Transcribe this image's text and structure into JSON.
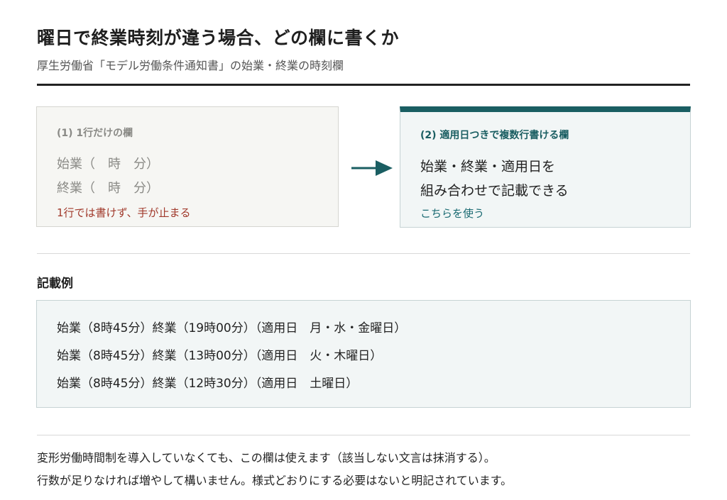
{
  "header": {
    "title": "曜日で終業時刻が違う場合、どの欄に書くか",
    "subtitle": "厚生労働省「モデル労働条件通知書」の始業・終業の時刻欄"
  },
  "comparison": {
    "left": {
      "heading": "(1) 1行だけの欄",
      "line1": "始業（　時　分）",
      "line2": "終業（　時　分）",
      "note": "1行では書けず、手が止まる"
    },
    "arrow_icon": "right-arrow-icon",
    "right": {
      "heading": "(2) 適用日つきで複数行書ける欄",
      "line1": "始業・終業・適用日を",
      "line2": "組み合わせで記載できる",
      "note": "こちらを使う"
    }
  },
  "example": {
    "label": "記載例",
    "rows": [
      "始業（8時45分）終業（19時00分）（適用日　月・水・金曜日）",
      "始業（8時45分）終業（13時00分）（適用日　火・木曜日）",
      "始業（8時45分）終業（12時30分）（適用日　土曜日）"
    ]
  },
  "footer": {
    "line1": "変形労働時間制を導入していなくても、この欄は使えます（該当しない文言は抹消する）。",
    "line2": "行数が足りなければ増やして構いません。様式どおりにする必要はないと明記されています。"
  },
  "colors": {
    "accent": "#1a5e62",
    "warning": "#a0382a",
    "muted": "#8a8a86",
    "panel": "#f2f6f6"
  }
}
